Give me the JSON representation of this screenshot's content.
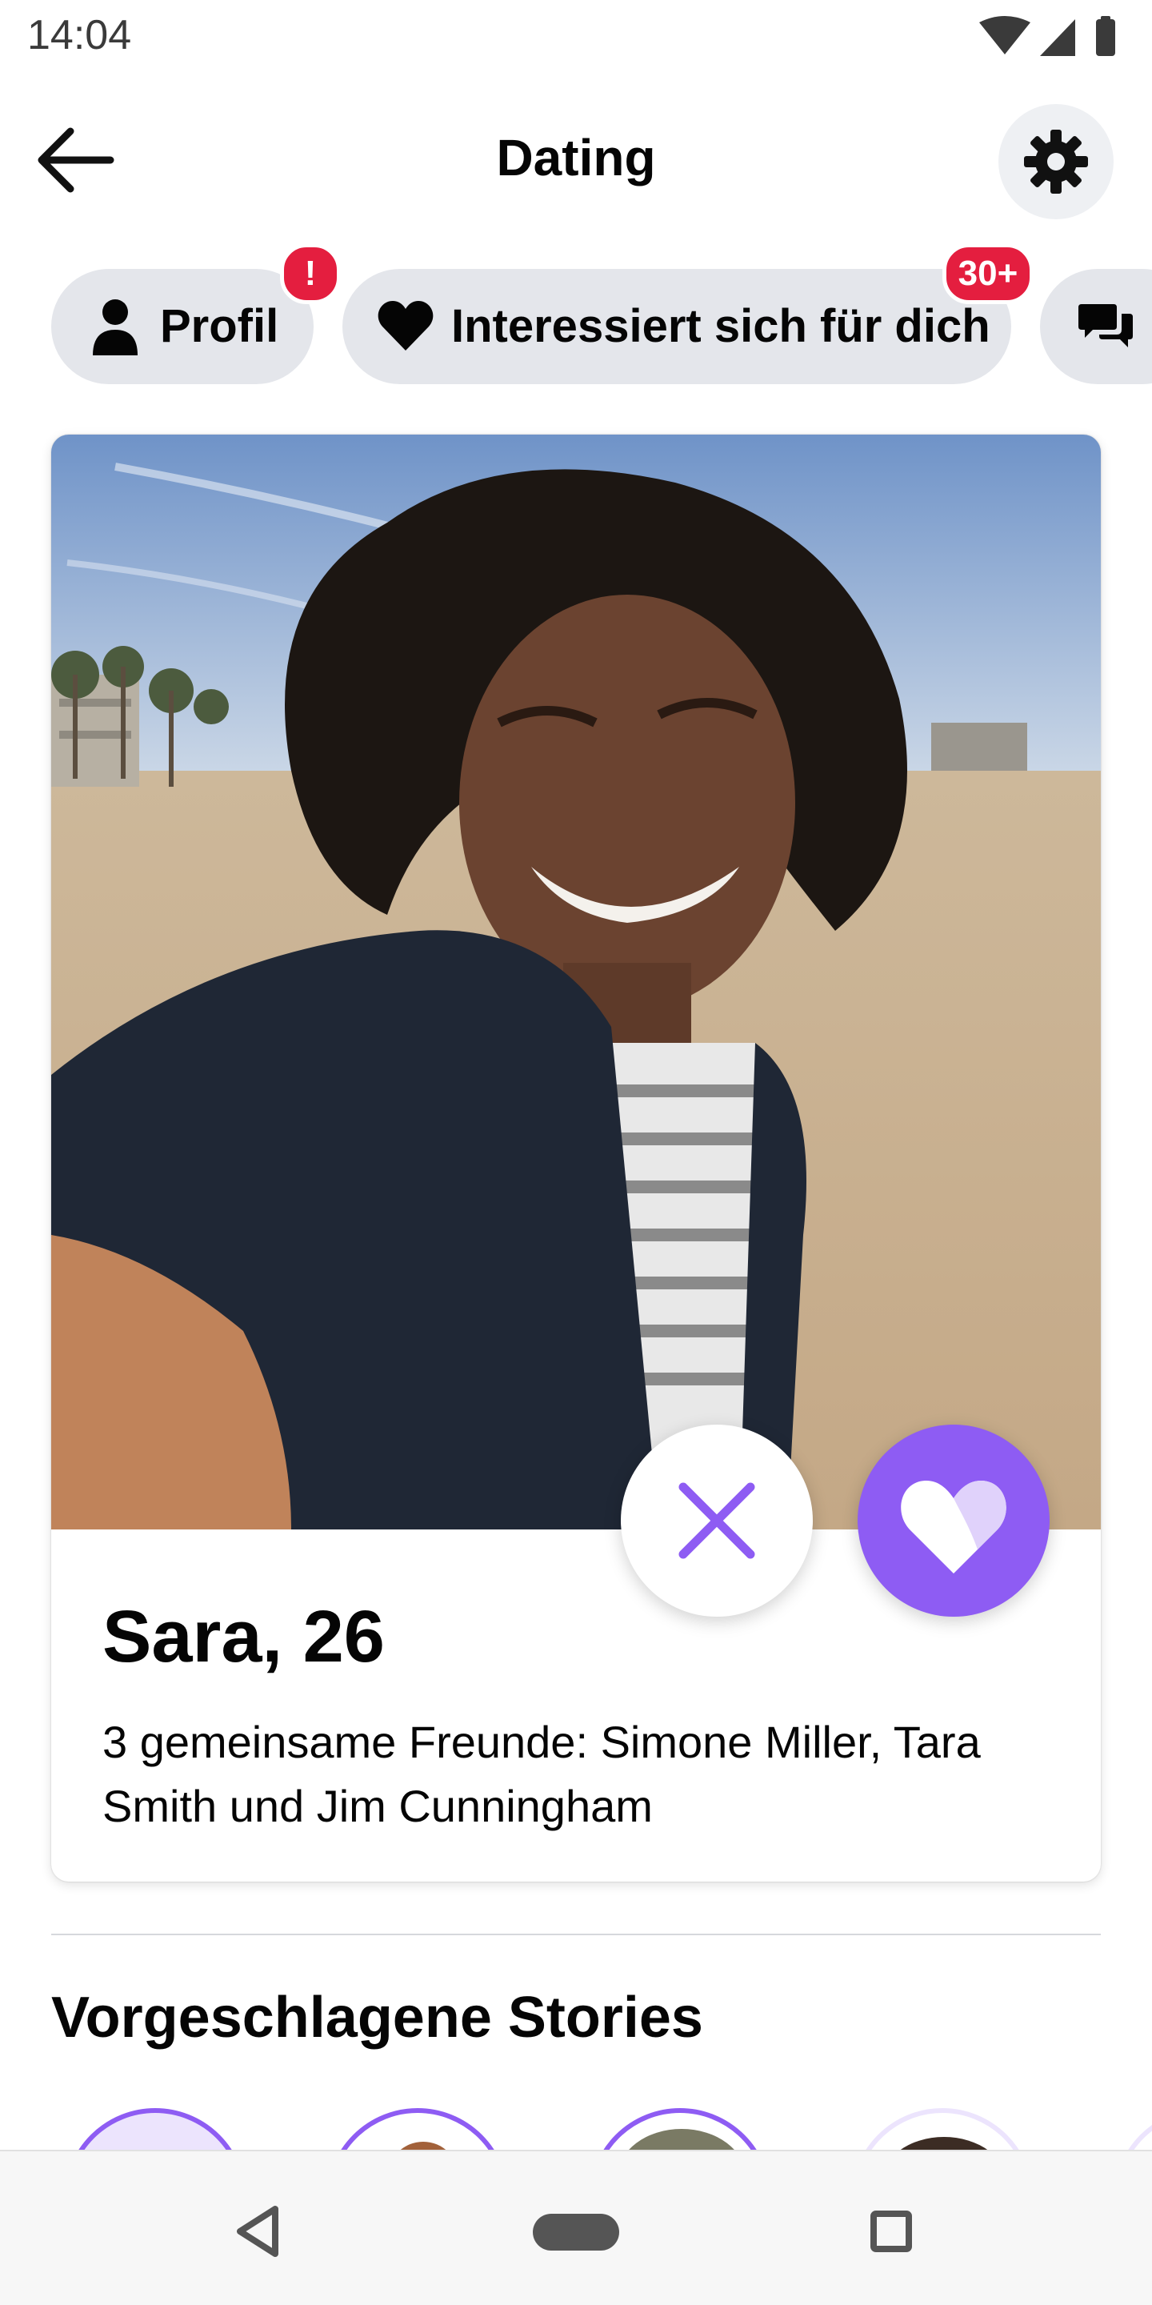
{
  "status_bar": {
    "time": "14:04"
  },
  "header": {
    "title": "Dating"
  },
  "chips": [
    {
      "label": "Profil",
      "badge": "!"
    },
    {
      "label": "Interessiert sich für dich",
      "badge": "30+"
    }
  ],
  "card": {
    "name": "Sara, 26",
    "description": "3 gemeinsame Freunde: Simone Miller, Tara Smith und Jim Cunningham"
  },
  "stories": {
    "title": "Vorgeschlagene Stories"
  },
  "colors": {
    "accent": "#8e5cf3",
    "badge": "#e41e3f",
    "chip": "#e4e6eb"
  },
  "icons": {
    "back": "arrow-left-icon",
    "settings": "gear-icon",
    "profile": "person-icon",
    "interested": "heart-icon",
    "messages": "chat-bubbles-icon",
    "pass": "x-icon",
    "like": "heart-icon"
  }
}
